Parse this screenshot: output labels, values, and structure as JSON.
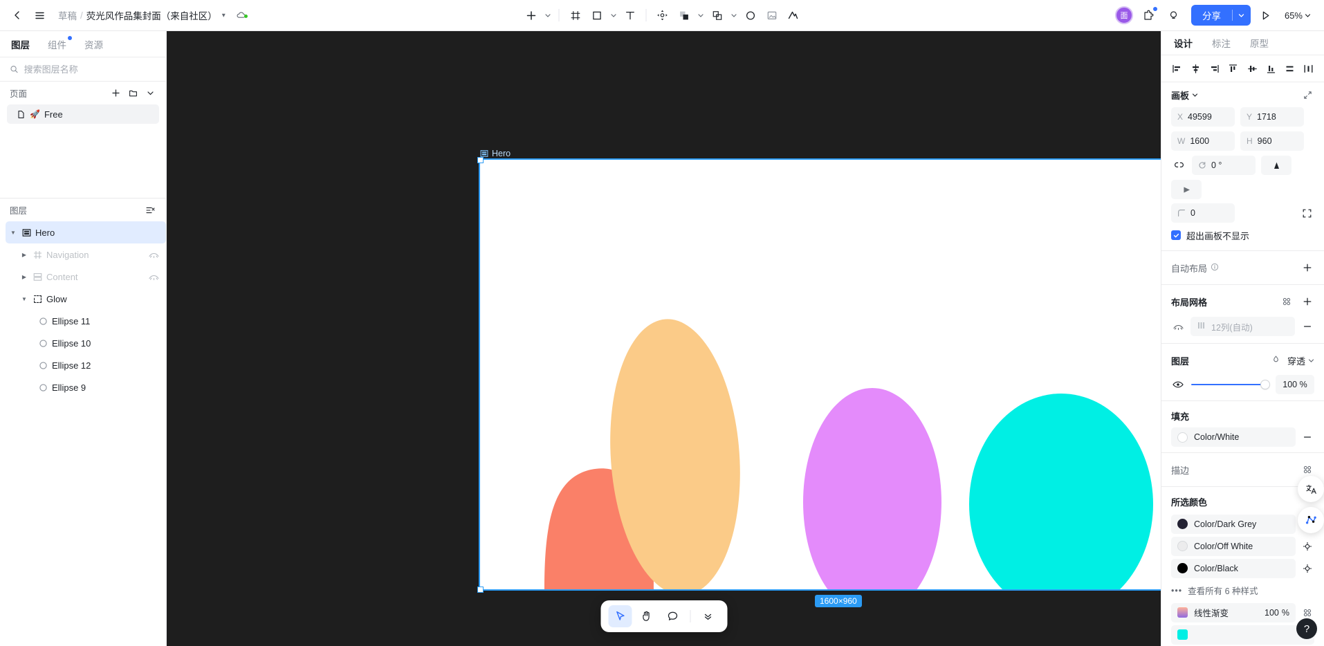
{
  "topbar": {
    "back_icon": "chevron-left-icon",
    "menu_icon": "hamburger-menu-icon",
    "breadcrumb_root": "草稿",
    "breadcrumb_sep": "/",
    "breadcrumb_file": "荧光风作品集封面（来自社区）",
    "cloud_icon": "cloud-sync-icon",
    "tools": [
      {
        "name": "add-icon",
        "label": "+",
        "has_caret": true
      },
      {
        "name": "frame-icon",
        "label": "",
        "has_caret": false
      },
      {
        "name": "shape-rect-icon",
        "label": "",
        "has_caret": true
      },
      {
        "name": "text-tool-icon",
        "label": "T",
        "has_caret": false
      },
      {
        "name": "move-transform-icon",
        "label": "",
        "has_caret": false
      },
      {
        "name": "component-icon",
        "label": "",
        "has_caret": true
      },
      {
        "name": "boolean-ops-icon",
        "label": "",
        "has_caret": true
      },
      {
        "name": "ellipse-icon",
        "label": "",
        "has_caret": false
      },
      {
        "name": "image-icon",
        "label": "",
        "has_caret": false
      },
      {
        "name": "ai-magic-icon",
        "label": "",
        "has_caret": false
      }
    ],
    "avatar_text": "面",
    "avatar_color": "#9a59e8",
    "plugin_icon": "plugin-icon",
    "idea_icon": "lightbulb-icon",
    "share_label": "分享",
    "share_color": "#3370ff",
    "present_icon": "play-present-icon",
    "zoom_level": "65%"
  },
  "left_panel": {
    "tabs": [
      {
        "label": "图层",
        "active": true,
        "dot": false
      },
      {
        "label": "组件",
        "active": false,
        "dot": true
      },
      {
        "label": "资源",
        "active": false,
        "dot": false
      }
    ],
    "search_placeholder": "搜索图层名称",
    "search_value": "",
    "pages_title": "页面",
    "page_actions": [
      "add-page-icon",
      "new-folder-icon",
      "collapse-chevron-icon"
    ],
    "pages": [
      {
        "label": "Free",
        "icon": "page-file-icon",
        "emoji": "🚀",
        "selected": true
      }
    ],
    "layers_title": "图层",
    "layers_filter_icon": "filter-layers-icon",
    "layers": [
      {
        "label": "Hero",
        "icon": "frame-board-icon",
        "depth": 0,
        "expanded": true,
        "selected": true,
        "dimmed": false,
        "hidden_icon": false
      },
      {
        "label": "Navigation",
        "icon": "auto-layout-icon",
        "depth": 1,
        "expanded": false,
        "selected": false,
        "dimmed": true,
        "hidden_icon": true
      },
      {
        "label": "Content",
        "icon": "stack-layout-icon",
        "depth": 1,
        "expanded": false,
        "selected": false,
        "dimmed": true,
        "hidden_icon": true
      },
      {
        "label": "Glow",
        "icon": "group-icon",
        "depth": 1,
        "expanded": true,
        "selected": false,
        "dimmed": false,
        "hidden_icon": false
      },
      {
        "label": "Ellipse 11",
        "icon": "ellipse-layer-icon",
        "depth": 2,
        "expanded": null,
        "selected": false,
        "dimmed": false,
        "hidden_icon": false
      },
      {
        "label": "Ellipse 10",
        "icon": "ellipse-layer-icon",
        "depth": 2,
        "expanded": null,
        "selected": false,
        "dimmed": false,
        "hidden_icon": false
      },
      {
        "label": "Ellipse 12",
        "icon": "ellipse-layer-icon",
        "depth": 2,
        "expanded": null,
        "selected": false,
        "dimmed": false,
        "hidden_icon": false
      },
      {
        "label": "Ellipse 9",
        "icon": "ellipse-layer-icon",
        "depth": 2,
        "expanded": null,
        "selected": false,
        "dimmed": false,
        "hidden_icon": false
      }
    ]
  },
  "canvas": {
    "background": "#1e1e1e",
    "artboard_name": "Hero",
    "artboard_fill": "#ffffff",
    "selection_color": "#2b9bf4",
    "size_badge": "1600×960",
    "blobs": [
      {
        "name": "ellipse-coral",
        "color": "#fa8068"
      },
      {
        "name": "ellipse-peach",
        "color": "#fbcb88"
      },
      {
        "name": "ellipse-magenta",
        "color": "#e48bfb"
      },
      {
        "name": "ellipse-cyan",
        "color": "#00efe4"
      }
    ],
    "toolbar": [
      {
        "name": "cursor-select-tool",
        "active": true
      },
      {
        "name": "hand-pan-tool",
        "active": false
      },
      {
        "name": "comment-tool",
        "active": false
      },
      {
        "name": "more-tools-chevron",
        "active": false
      }
    ]
  },
  "right_panel": {
    "tabs": [
      {
        "label": "设计",
        "active": true
      },
      {
        "label": "标注",
        "active": false
      },
      {
        "label": "原型",
        "active": false
      }
    ],
    "align_icons": [
      "align-left-icon",
      "align-horizontal-center-icon",
      "align-right-icon",
      "align-top-icon",
      "align-vertical-center-icon",
      "align-bottom-icon",
      "distribute-vertical-icon",
      "distribute-horizontal-icon"
    ],
    "section_board": {
      "title": "画板",
      "expand_icon": "expand-collapse-icon",
      "x_label": "X",
      "x_value": "49599",
      "y_label": "Y",
      "y_value": "1718",
      "w_label": "W",
      "w_value": "1600",
      "h_label": "H",
      "h_value": "960",
      "link_icon": "link-ratio-icon",
      "rotation_label": "rotate-icon",
      "rotation_value": "0 °",
      "flip_h_icon": "flip-horizontal-icon",
      "flip_v_icon": "flip-vertical-icon",
      "corner_label": "corner-radius-icon",
      "corner_value": "0",
      "corner_independent_icon": "independent-corners-icon",
      "clip_label": "超出画板不显示",
      "clip_checked": true
    },
    "section_autolayout": {
      "title": "自动布局",
      "info_icon": "info-circle-icon",
      "add_icon": "plus-icon"
    },
    "section_grid": {
      "title": "布局网格",
      "style_icon": "apply-style-icon",
      "add_icon": "plus-icon",
      "visibility_icon": "hidden-eye-icon",
      "grid_type_icon": "columns-grid-icon",
      "grid_value": "12列(自动)",
      "remove_icon": "minus-icon"
    },
    "section_layer": {
      "title": "图层",
      "blend_icon": "blend-mode-icon",
      "blend_mode": "穿透",
      "eye_icon": "eye-visible-icon",
      "opacity": "100 %"
    },
    "section_fill": {
      "title": "填充",
      "items": [
        {
          "label": "Color/White",
          "color": "#ffffff",
          "swatch": "circle",
          "action": "minus-icon"
        }
      ]
    },
    "section_stroke": {
      "title": "描边",
      "style_icon": "apply-style-icon"
    },
    "section_selected_colors": {
      "title": "所选颜色",
      "items": [
        {
          "label": "Color/Dark Grey",
          "color": "#242233",
          "swatch": "circle",
          "action": "target-icon"
        },
        {
          "label": "Color/Off White",
          "color": "#ececed",
          "swatch": "circle",
          "action": "target-icon"
        },
        {
          "label": "Color/Black",
          "color": "#000000",
          "swatch": "circle",
          "action": "target-icon"
        }
      ],
      "more_label": "查看所有 6 种样式",
      "more_icon": "ellipsis-icon",
      "gradient_item": {
        "label": "线性渐变",
        "value": "100",
        "unit": "%",
        "swatch": "gradient",
        "gradient_from": "#ffb199",
        "gradient_to": "#8f6ae0",
        "style_icon": "apply-style-icon"
      },
      "last_item": {
        "label": "",
        "color": "#00efe4",
        "swatch": "square"
      }
    },
    "fabs": [
      {
        "name": "translate-text-fab"
      },
      {
        "name": "vector-network-fab"
      }
    ],
    "help_label": "?"
  }
}
